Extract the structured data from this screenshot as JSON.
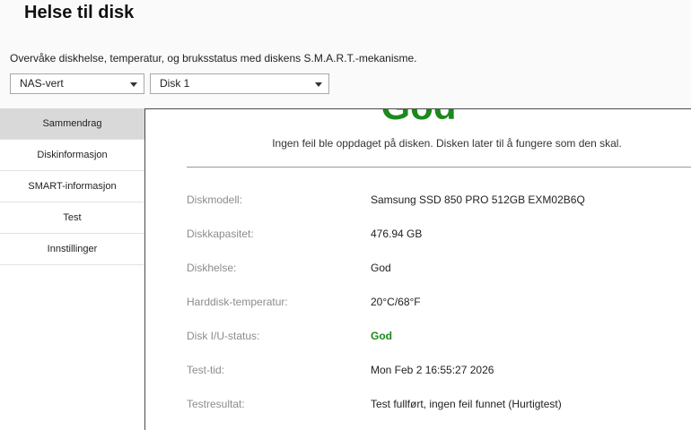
{
  "header": {
    "title": "Helse til disk",
    "description": "Overvåke diskhelse, temperatur, og bruksstatus med diskens S.M.A.R.T.-mekanisme."
  },
  "selectors": {
    "host": "NAS-vert",
    "disk": "Disk 1"
  },
  "sidebar": {
    "items": [
      {
        "label": "Sammendrag",
        "active": true
      },
      {
        "label": "Diskinformasjon",
        "active": false
      },
      {
        "label": "SMART-informasjon",
        "active": false
      },
      {
        "label": "Test",
        "active": false
      },
      {
        "label": "Innstillinger",
        "active": false
      }
    ]
  },
  "summary": {
    "status": "God",
    "message": "Ingen feil ble oppdaget på disken. Disken later til å fungere som den skal.",
    "rows": [
      {
        "label": "Diskmodell:",
        "value": "Samsung SSD 850 PRO 512GB EXM02B6Q"
      },
      {
        "label": "Diskkapasitet:",
        "value": "476.94 GB"
      },
      {
        "label": "Diskhelse:",
        "value": "God"
      },
      {
        "label": "Harddisk-temperatur:",
        "value": "20°C/68°F"
      },
      {
        "label": "Disk I/U-status:",
        "value": "God"
      },
      {
        "label": "Test-tid:",
        "value": "Mon Feb 2 16:55:27 2026"
      },
      {
        "label": "Testresultat:",
        "value": "Test fullført, ingen feil funnet (Hurtigtest)"
      }
    ]
  },
  "colors": {
    "good": "#1a8a1a",
    "active_tab": "#d9d9d9",
    "label": "#8c8c8c"
  }
}
